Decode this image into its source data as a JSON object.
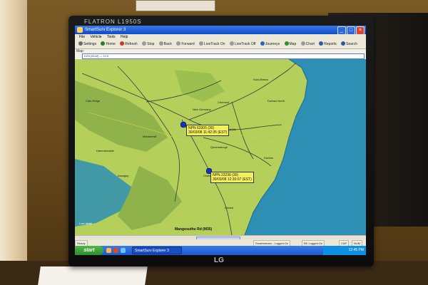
{
  "monitor": {
    "brand": "FLATRON L1950S",
    "logo": "LG"
  },
  "app": {
    "title": "SmartSurv Explorer 3"
  },
  "menu": [
    "File",
    "Vehicle",
    "Tools",
    "Help"
  ],
  "toolbar": [
    {
      "label": "Settings",
      "icon": "settings-icon",
      "color": "#6a6a6a"
    },
    {
      "label": "Home",
      "icon": "home-icon",
      "color": "#2b7a2b"
    },
    {
      "label": "Refresh",
      "icon": "refresh-icon",
      "color": "#c53a2a"
    },
    {
      "label": "Stop",
      "icon": "stop-icon",
      "color": "#9a9a9a"
    },
    {
      "label": "Back",
      "icon": "back-icon",
      "color": "#9a9a9a"
    },
    {
      "label": "Forward",
      "icon": "forward-icon",
      "color": "#9a9a9a"
    },
    {
      "label": "LiveTrack On",
      "icon": "livetrack-on-icon",
      "color": "#9a9a9a"
    },
    {
      "label": "LiveTrack Off",
      "icon": "livetrack-off-icon",
      "color": "#9a9a9a"
    },
    {
      "label": "Journeys",
      "icon": "journeys-icon",
      "color": "#2e63c8"
    },
    {
      "label": "Map",
      "icon": "map-icon",
      "color": "#2e8c2e"
    },
    {
      "label": "Chart",
      "icon": "chart-icon",
      "color": "#9a9a9a"
    },
    {
      "label": "Reports",
      "icon": "reports-icon",
      "color": "#3058a8"
    },
    {
      "label": "Search",
      "icon": "search-icon",
      "color": "#3058a8"
    }
  ],
  "address": {
    "label": "Map",
    "value": "KZN [5142] — 12.0"
  },
  "map": {
    "place_labels": [
      {
        "text": "Kwa-Mashu"
      },
      {
        "text": "Durban North"
      },
      {
        "text": "Clermont"
      },
      {
        "text": "New Germany"
      },
      {
        "text": "Pinetown"
      },
      {
        "text": "Westville"
      },
      {
        "text": "Queensburgh"
      },
      {
        "text": "Durban"
      },
      {
        "text": "Chatsworth"
      },
      {
        "text": "Umlazi"
      },
      {
        "text": "Mariannhill"
      },
      {
        "text": "Hammarsdale"
      },
      {
        "text": "Assagay"
      },
      {
        "text": "Cato Ridge"
      }
    ],
    "vehicles": [
      {
        "name": "NPN 63305 (30)",
        "time": "30/03/08 11:42:35 (EST)"
      },
      {
        "name": "NPN 23236 (30)",
        "time": "30/03/08 12:30:07 (EST)"
      }
    ],
    "scale": "Low detail",
    "bottom_road": "Mangosuthu Rd (M35)"
  },
  "status": {
    "left": "Ready",
    "middle1": "Smartstream - Logged On",
    "middle2": "BK Logged On",
    "right1": "CAP",
    "right2": "NUM"
  },
  "taskbar": {
    "start": "start",
    "task": "SmartSurv Explorer 3",
    "clock": "12:45 PM"
  },
  "colors": {
    "land": "#b4cf5a",
    "land_dark": "#8fb24a",
    "sea": "#2d8fb4",
    "road": "#3a3a3a",
    "callout": "#f3f060"
  }
}
